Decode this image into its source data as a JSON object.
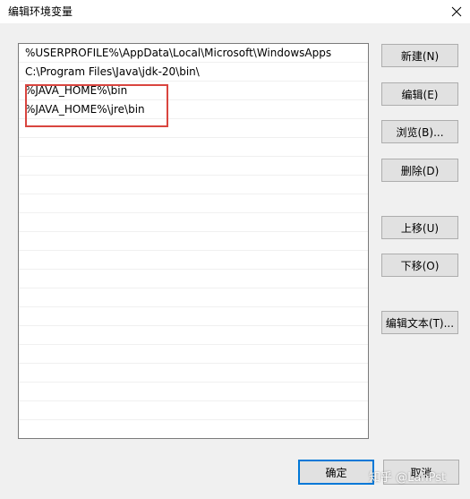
{
  "window": {
    "title": "编辑环境变量"
  },
  "paths": [
    "%USERPROFILE%\\AppData\\Local\\Microsoft\\WindowsApps",
    "C:\\Program Files\\Java\\jdk-20\\bin\\",
    "%JAVA_HOME%\\bin",
    "%JAVA_HOME%\\jre\\bin",
    "",
    "",
    "",
    "",
    "",
    "",
    "",
    "",
    "",
    "",
    "",
    "",
    "",
    "",
    "",
    "",
    ""
  ],
  "buttons": {
    "new": "新建(N)",
    "edit": "编辑(E)",
    "browse": "浏览(B)...",
    "delete": "删除(D)",
    "move_up": "上移(U)",
    "move_down": "下移(O)",
    "edit_text": "编辑文本(T)...",
    "ok": "确定",
    "cancel": "取消"
  },
  "watermark": "知乎 @LanPst",
  "colors": {
    "highlight": "#d9453f",
    "focus": "#0078d7"
  }
}
